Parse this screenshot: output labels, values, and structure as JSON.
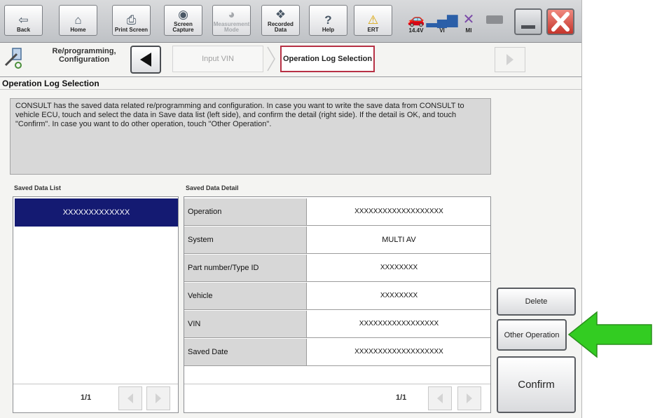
{
  "toolbar": {
    "buttons": [
      {
        "label": "Back",
        "icon": "back-arrow-icon"
      },
      {
        "label": "Home",
        "icon": "home-icon"
      },
      {
        "label": "Print Screen",
        "icon": "printer-icon"
      },
      {
        "label": "Screen Capture",
        "icon": "camera-icon"
      },
      {
        "label": "Measurement Mode",
        "icon": "measurement-icon"
      },
      {
        "label": "Recorded Data",
        "icon": "recorded-data-icon"
      },
      {
        "label": "Help",
        "icon": "help-icon"
      },
      {
        "label": "ERT",
        "icon": "warning-icon"
      }
    ],
    "status": {
      "battery": "14.4V",
      "vi": "VI",
      "mi": "MI"
    }
  },
  "nav": {
    "title": "Re/programming, Configuration",
    "step_input_vin": "Input VIN",
    "step_current": "Operation Log Selection"
  },
  "section_title": "Operation Log Selection",
  "message": "CONSULT has the saved data related re/programming and configuration. In case you want to write the save data from CONSULT to vehicle ECU, touch and select the data in Save data list (left side), and confirm the detail (right side). If the detail is OK, and touch \"Confirm\". In case you want to do other operation, touch \"Other Operation\".",
  "saved_list": {
    "header": "Saved Data List",
    "items": [
      "XXXXXXXXXXXXX"
    ],
    "page": "1/1"
  },
  "detail": {
    "header": "Saved Data Detail",
    "rows": [
      {
        "label": "Operation",
        "value": "XXXXXXXXXXXXXXXXXXX"
      },
      {
        "label": "System",
        "value": "MULTI AV"
      },
      {
        "label": "Part number/Type ID",
        "value": "XXXXXXXX"
      },
      {
        "label": "Vehicle",
        "value": "XXXXXXXX"
      },
      {
        "label": "VIN",
        "value": "XXXXXXXXXXXXXXXXX"
      },
      {
        "label": "Saved Date",
        "value": "XXXXXXXXXXXXXXXXXXX"
      }
    ],
    "page": "1/1"
  },
  "actions": {
    "delete": "Delete",
    "other_operation": "Other Operation",
    "confirm": "Confirm"
  },
  "colors": {
    "selection": "#141a72",
    "active_step_border": "#b73145",
    "close_button": "#d9473e",
    "callout_arrow": "#33cc22"
  }
}
